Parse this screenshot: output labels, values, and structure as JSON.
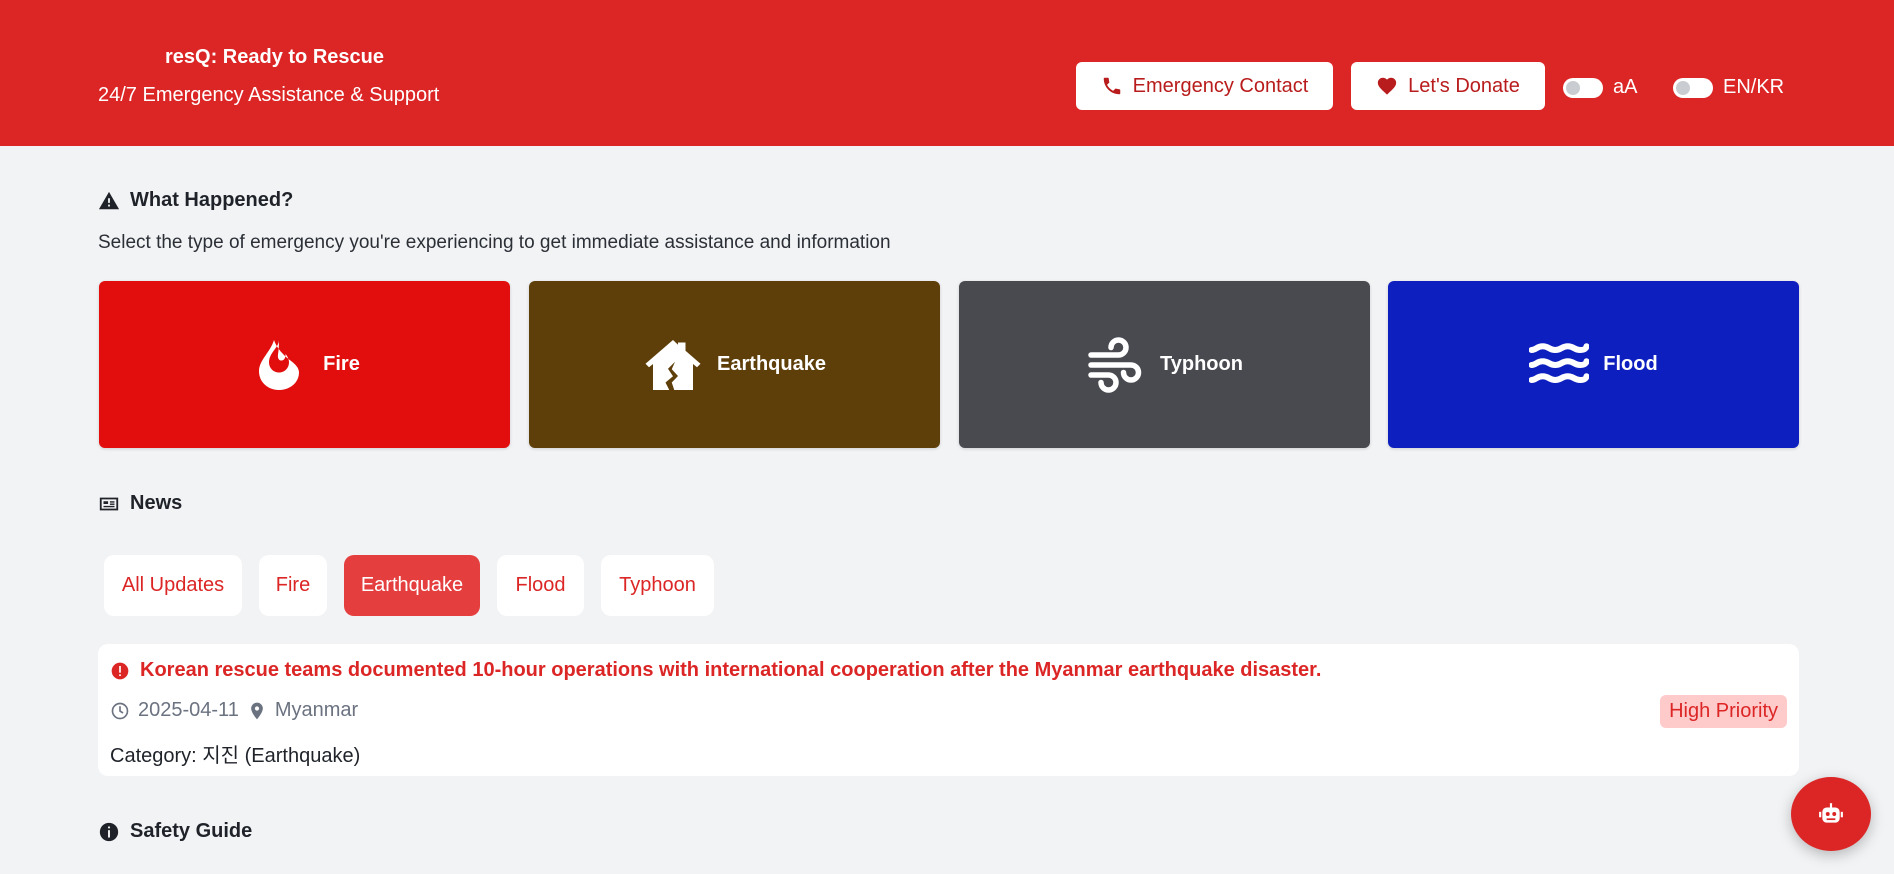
{
  "header": {
    "title": "resQ: Ready to Rescue",
    "subtitle": "24/7 Emergency Assistance & Support",
    "emergency_contact_label": "Emergency Contact",
    "donate_label": "Let's Donate",
    "font_toggle_label": "aA",
    "lang_toggle_label": "EN/KR"
  },
  "what_happened": {
    "heading": "What Happened?",
    "intro": "Select the type of emergency you're experiencing to get immediate assistance and information",
    "cards": [
      {
        "label": "Fire",
        "icon": "fire-icon",
        "color": "#e20e0e"
      },
      {
        "label": "Earthquake",
        "icon": "house-crack-icon",
        "color": "#5e3e09"
      },
      {
        "label": "Typhoon",
        "icon": "wind-icon",
        "color": "#484a50"
      },
      {
        "label": "Flood",
        "icon": "water-icon",
        "color": "#0e1fbf"
      }
    ]
  },
  "news": {
    "heading": "News",
    "filters": [
      "All Updates",
      "Fire",
      "Earthquake",
      "Flood",
      "Typhoon"
    ],
    "active_filter": "Earthquake",
    "item": {
      "headline": "Korean rescue teams documented 10-hour operations with international cooperation after the Myanmar earthquake disaster.",
      "date": "2025-04-11",
      "location": "Myanmar",
      "priority": "High Priority",
      "category": "Category: 지진 (Earthquake)"
    }
  },
  "safety_guide": {
    "heading": "Safety Guide"
  },
  "colors": {
    "brand_red": "#dc2626",
    "background": "#f2f3f5"
  }
}
